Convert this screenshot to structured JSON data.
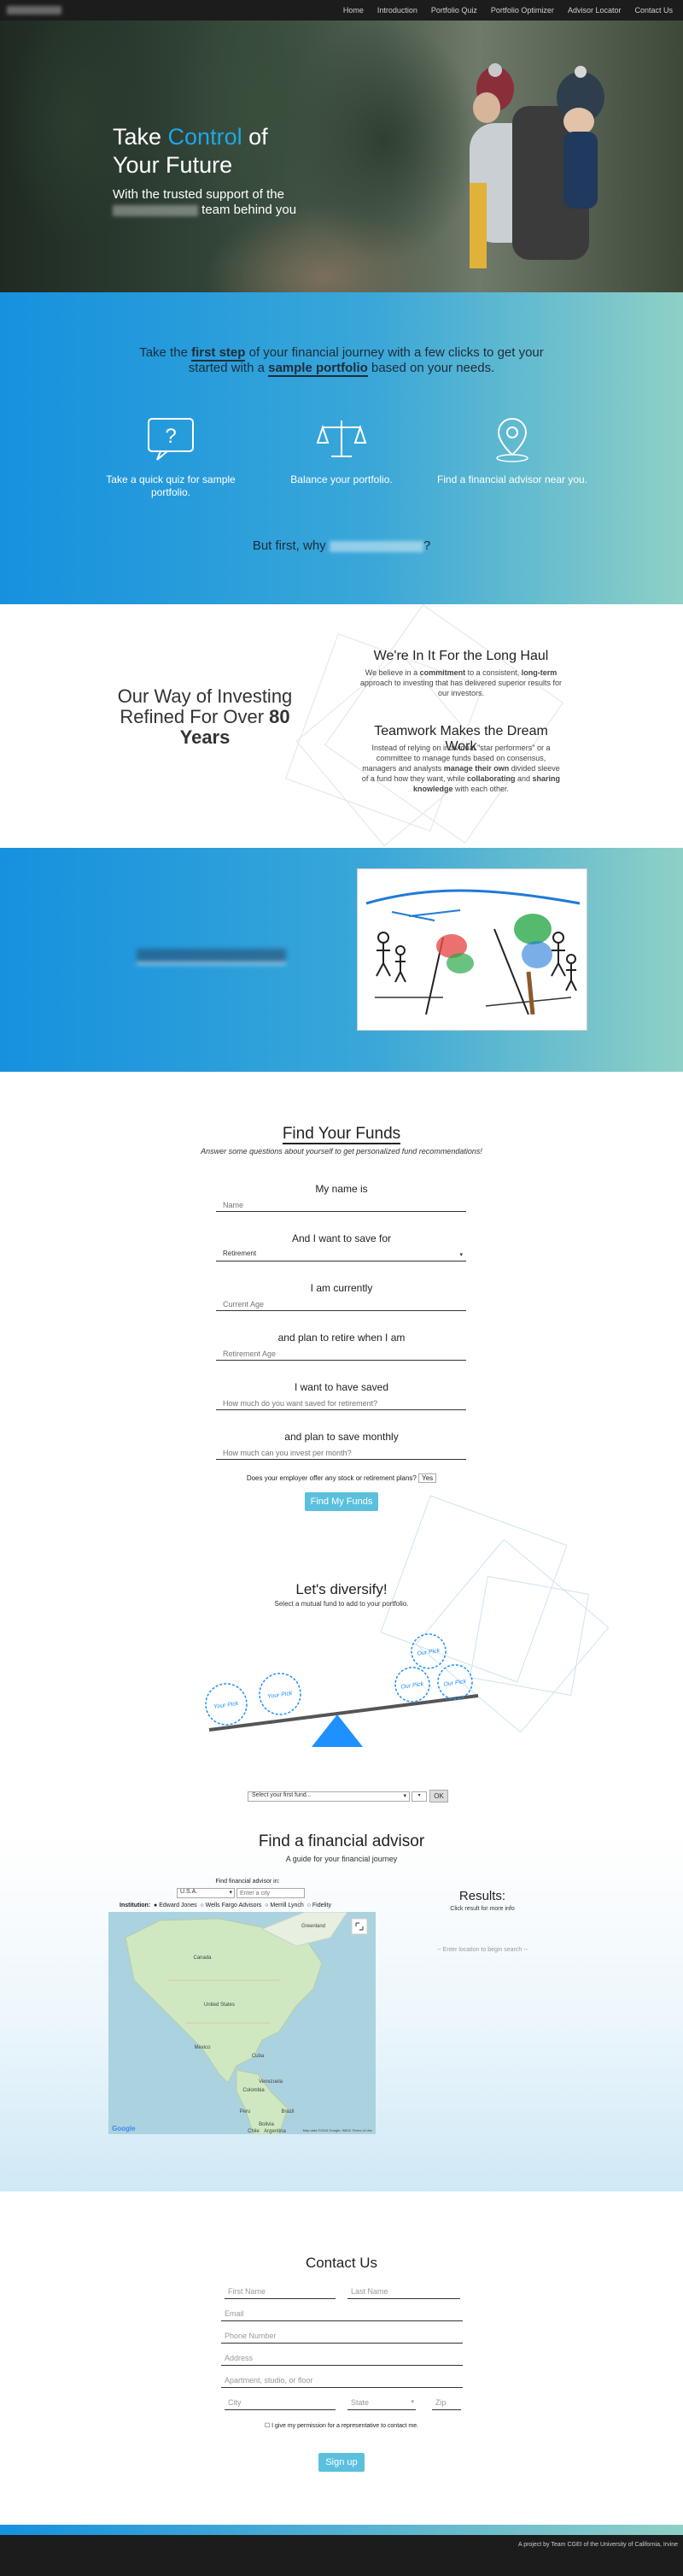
{
  "nav": {
    "items": [
      "Home",
      "Introduction",
      "Portfolio Quiz",
      "Portfolio Optimizer",
      "Advisor Locator",
      "Contact Us"
    ]
  },
  "hero": {
    "title_1": "Take ",
    "title_accent": "Control",
    "title_2": " of",
    "title_3": "Your Future",
    "sub_1": "With the trusted support of the",
    "sub_2": "team behind you"
  },
  "journey": {
    "t1": "Take the ",
    "t_bold1": "first step",
    "t2": " of your financial journey with a few clicks to get your started with a ",
    "t_bold2": "sample portfolio",
    "t3": " based on your needs.",
    "features": [
      {
        "label": "Take a quick quiz for sample portfolio."
      },
      {
        "label": "Balance your portfolio."
      },
      {
        "label": "Find a financial advisor near you."
      }
    ],
    "why_prefix": "But first, why",
    "why_suffix": "?"
  },
  "way": {
    "title_1": "Our Way of Investing",
    "title_2": "Refined For Over ",
    "title_bold": "80",
    "title_3": "Years",
    "h1": "We're In It For the Long Haul",
    "p1_a": "We believe in a ",
    "p1_b": "commitment",
    "p1_c": " to a consistent, ",
    "p1_d": "long-term",
    "p1_e": " approach to investing that has delivered superior results for our investors.",
    "h2": "Teamwork Makes the Dream Work",
    "p2_a": "Instead of relying on individual \"star performers\" or a committee to manage funds based on consensus, managers and analysts ",
    "p2_b": "manage their own",
    "p2_c": " divided sleeve of a fund how they want, while ",
    "p2_d": "collaborating",
    "p2_e": " and ",
    "p2_f": "sharing knowledge",
    "p2_g": " with each other."
  },
  "funds": {
    "title": "Find Your Funds",
    "subtitle": "Answer some questions about yourself to get personalized fund recommendations!",
    "q1": "My name is",
    "q1_ph": "Name",
    "q2": "And I want to save for",
    "q2_val": "Retirement",
    "q3": "I am currently",
    "q3_ph": "Current Age",
    "q4": "and plan to retire when I am",
    "q4_ph": "Retirement Age",
    "q5": "I want to have saved",
    "q5_ph": "How much do you want saved for retirement?",
    "q6": "and plan to save monthly",
    "q6_ph": "How much can you invest per month?",
    "employer_q": "Does your employer offer any stock or retirement plans?",
    "employer_val": "Yes",
    "submit": "Find My Funds"
  },
  "diversify": {
    "title": "Let's diversify!",
    "subtitle": "Select a mutual fund to add to your portfolio.",
    "left_picks": [
      "Your Pick",
      "Your Pick"
    ],
    "right_picks": [
      "Our Pick",
      "Our Pick",
      "Our Pick"
    ],
    "select_ph": "Select your first fund...",
    "ok": "OK"
  },
  "advisor": {
    "title": "Find a financial advisor",
    "subtitle": "A guide for your financial journey",
    "in_label": "Find financial advisor in:",
    "country": "U.S.A.",
    "city_ph": "Enter a city",
    "institution_label": "Institution:",
    "institutions": [
      "Edward Jones",
      "Wells Fargo Advisors",
      "Merrill Lynch",
      "Fidelity"
    ],
    "results_title": "Results:",
    "results_sub": "Click result for more info",
    "results_empty": "-- Enter location to begin search --",
    "map_labels": [
      "Canada",
      "United States",
      "Mexico",
      "Cuba",
      "Venezuela",
      "Colombia",
      "Peru",
      "Brazil",
      "Bolivia",
      "Chile",
      "Argentina",
      "Greenland"
    ],
    "map_google": "Google",
    "map_credit": "Map data ©2019 Google, INEGI    Terms of Use"
  },
  "contact": {
    "title": "Contact Us",
    "first_ph": "First Name",
    "last_ph": "Last Name",
    "email_ph": "Email",
    "phone_ph": "Phone Number",
    "address_ph": "Address",
    "apt_ph": "Apartment, studio, or floor",
    "city_ph": "City",
    "state_ph": "State",
    "zip_ph": "Zip",
    "checkbox_label": "I give my permission for a representative to contact me.",
    "submit": "Sign up"
  },
  "footer": {
    "text": "A project by Team CGEI of the University of California, Irvine"
  },
  "colors": {
    "accent": "#1ea7e6",
    "button": "#5bc0de",
    "gradient_start": "#1591de",
    "gradient_end": "#8fd0c6"
  }
}
